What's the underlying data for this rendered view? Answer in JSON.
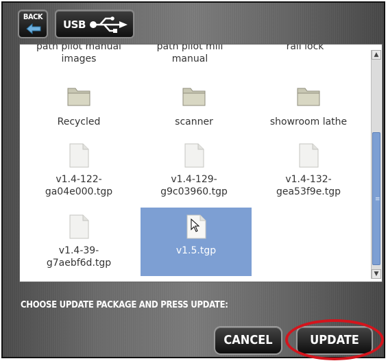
{
  "toolbar": {
    "back_label": "BACK",
    "usb_label": "USB"
  },
  "files": [
    {
      "label": "path pilot manual\nimages",
      "type": "folder"
    },
    {
      "label": "path pilot mill\nmanual",
      "type": "folder"
    },
    {
      "label": "rail lock",
      "type": "folder"
    },
    {
      "label": "Recycled",
      "type": "folder"
    },
    {
      "label": "scanner",
      "type": "folder"
    },
    {
      "label": "showroom lathe",
      "type": "folder"
    },
    {
      "label": "v1.4-122-\nga04e000.tgp",
      "type": "file"
    },
    {
      "label": "v1.4-129-\ng9c03960.tgp",
      "type": "file"
    },
    {
      "label": "v1.4-132-\ngea53f9e.tgp",
      "type": "file"
    },
    {
      "label": "v1.4-39-\ng7aebf6d.tgp",
      "type": "file"
    },
    {
      "label": "v1.5.tgp",
      "type": "file",
      "selected": true
    }
  ],
  "prompt": "CHOOSE UPDATE PACKAGE AND PRESS UPDATE:",
  "actions": {
    "cancel_label": "CANCEL",
    "update_label": "UPDATE"
  },
  "colors": {
    "selection": "#7d9fd3",
    "highlight_ring": "#d4141c"
  }
}
